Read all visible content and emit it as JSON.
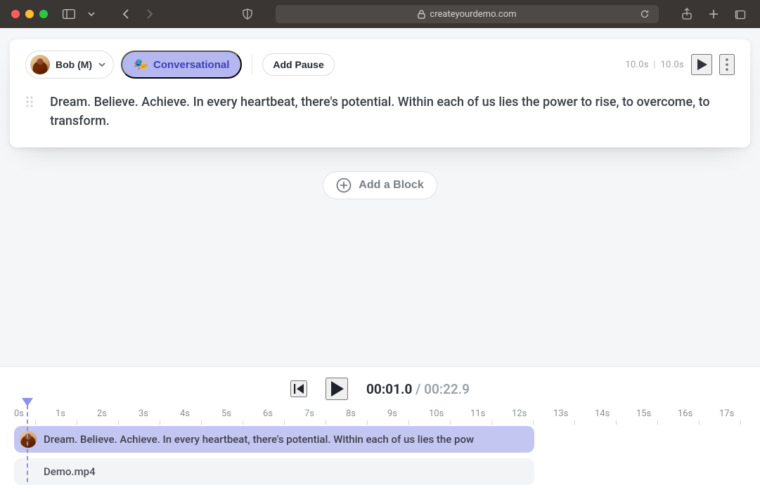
{
  "browser": {
    "url_display": "createyourdemo.com"
  },
  "block": {
    "voice_name": "Bob (M)",
    "style_label": "Conversational",
    "add_pause_label": "Add Pause",
    "duration_current": "10.0s",
    "duration_total": "10.0s",
    "script_text": "Dream. Believe. Achieve. In every heartbeat, there's potential. Within  each of us lies the power to rise, to overcome, to transform."
  },
  "add_block_label": "Add a Block",
  "timeline": {
    "time_current": "00:01.0",
    "time_total": "00:22.9",
    "ruler_labels": [
      "0s",
      "1s",
      "2s",
      "3s",
      "4s",
      "5s",
      "6s",
      "7s",
      "8s",
      "9s",
      "10s",
      "11s",
      "12s",
      "13s",
      "14s",
      "15s",
      "16s",
      "17s"
    ],
    "voice_clip_text": "Dream. Believe. Achieve. In every heartbeat, there's potential. Within each of us lies the pow",
    "media_clip_text": "Demo.mp4"
  }
}
